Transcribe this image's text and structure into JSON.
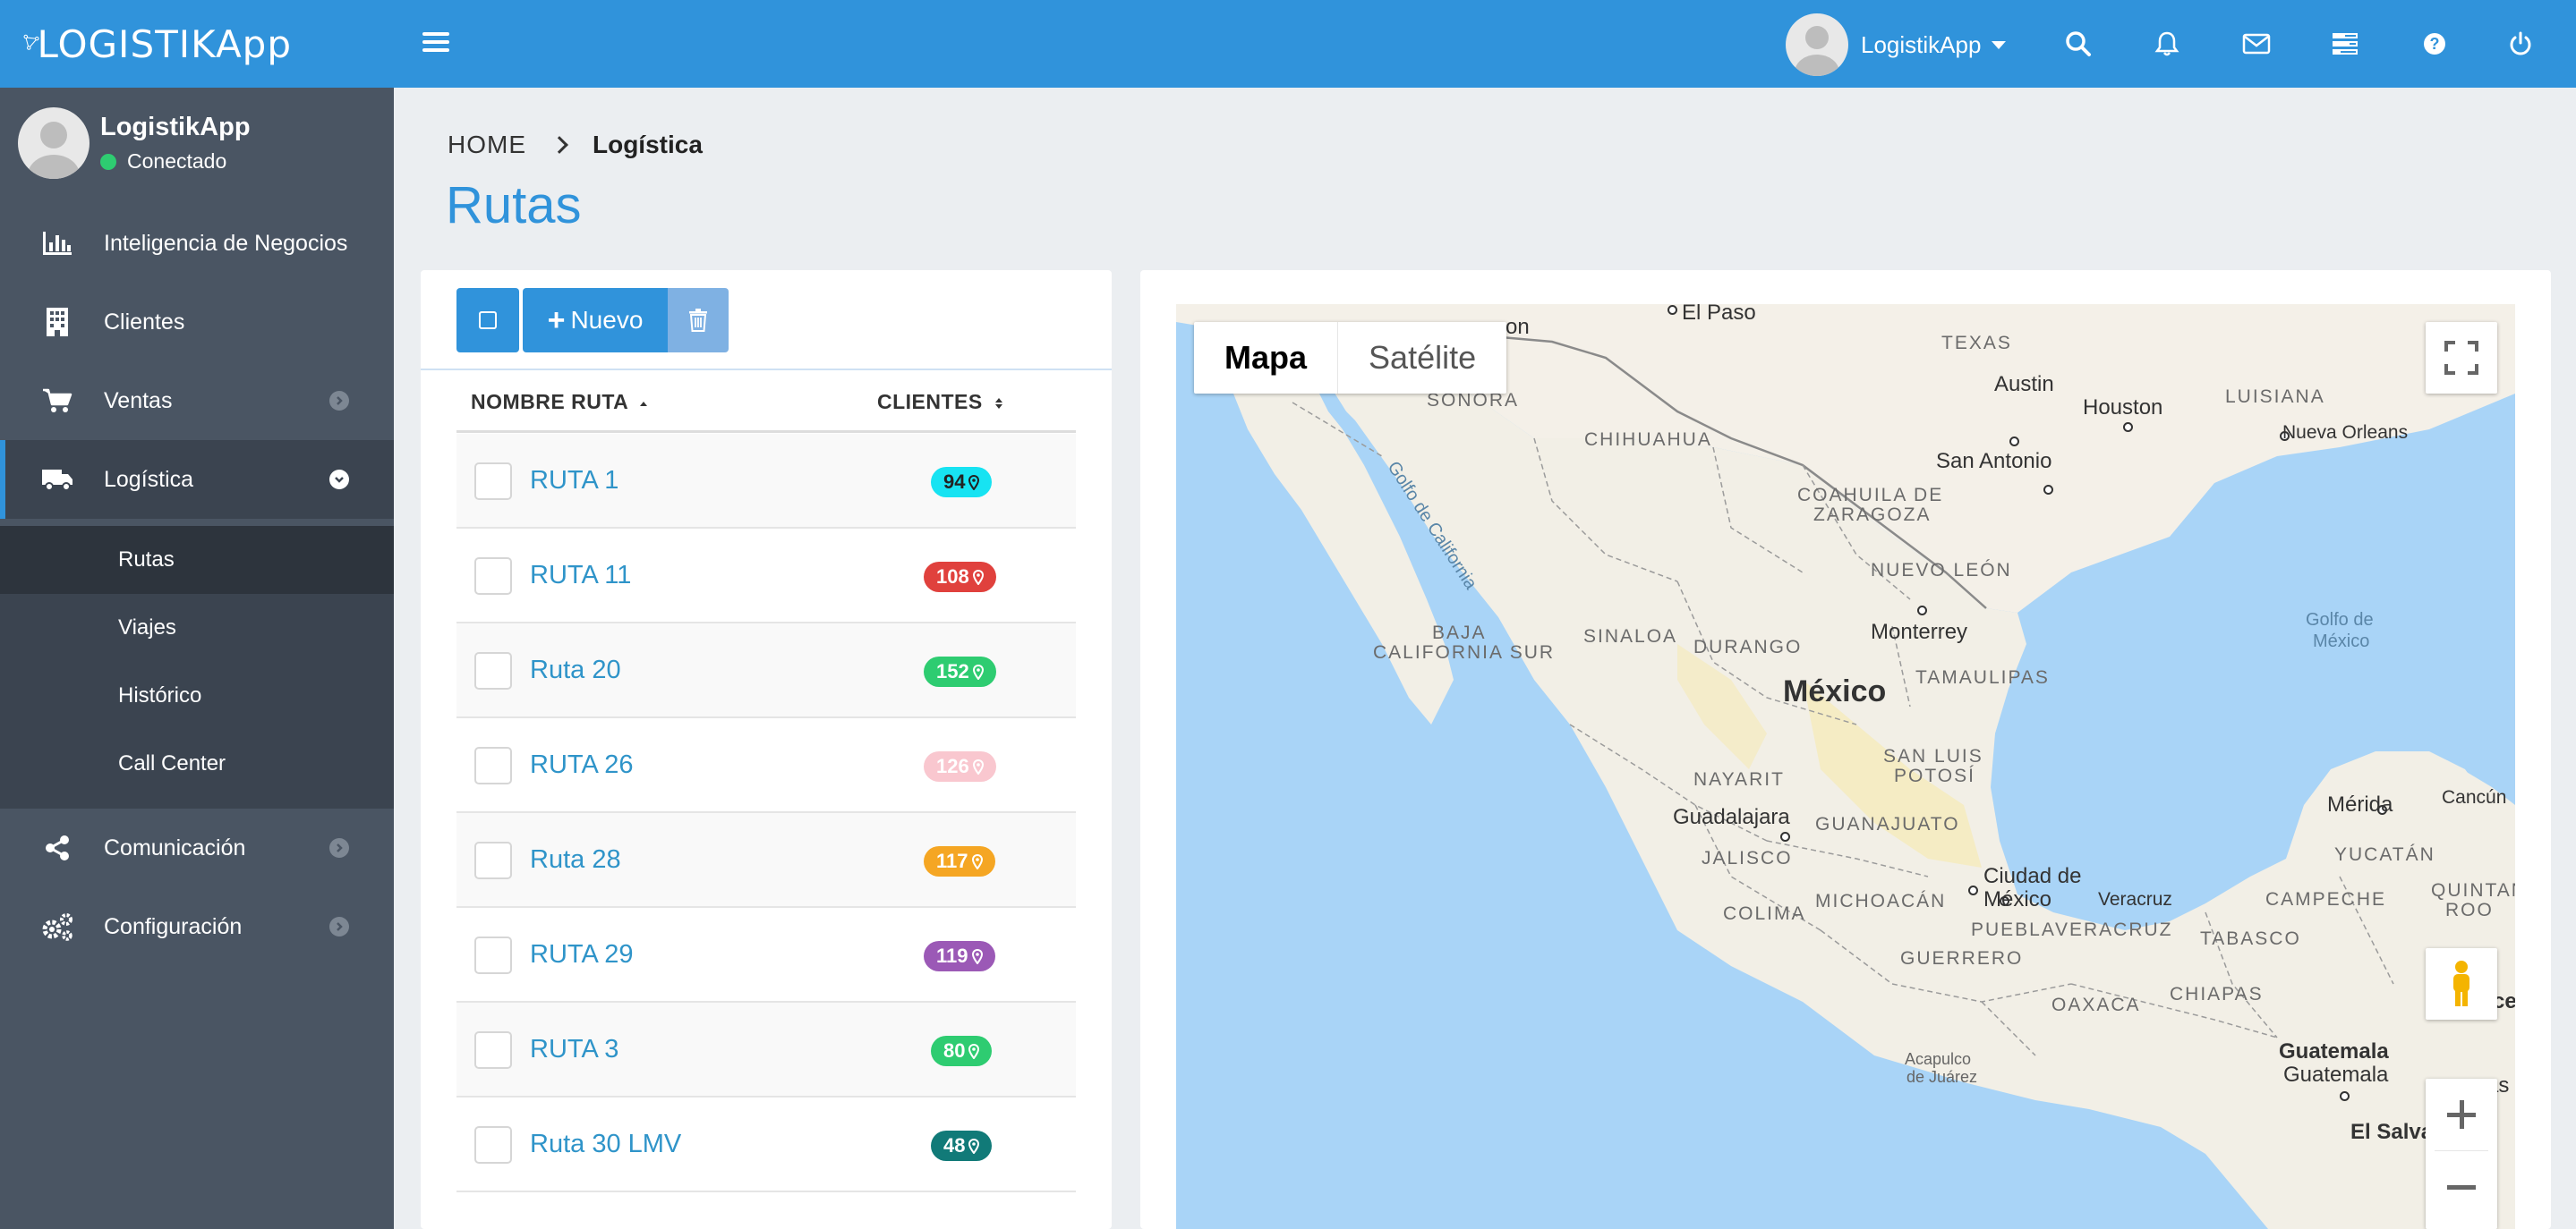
{
  "app": {
    "logo_text": "LOGISTIKApp",
    "user_name": "LogistikApp",
    "status": "Conectado"
  },
  "topbar": {
    "icons": [
      "search-icon",
      "bell-icon",
      "envelope-icon",
      "tasks-icon",
      "question-icon",
      "power-icon"
    ]
  },
  "sidebar": {
    "items": [
      {
        "label": "Inteligencia de Negocios",
        "icon": "bar-chart-icon"
      },
      {
        "label": "Clientes",
        "icon": "building-icon"
      },
      {
        "label": "Ventas",
        "icon": "cart-icon"
      },
      {
        "label": "Logística",
        "icon": "truck-icon"
      },
      {
        "label": "Comunicación",
        "icon": "share-icon"
      },
      {
        "label": "Configuración",
        "icon": "cogs-icon"
      }
    ],
    "subitems": [
      {
        "label": "Rutas"
      },
      {
        "label": "Viajes"
      },
      {
        "label": "Histórico"
      },
      {
        "label": "Call Center"
      }
    ]
  },
  "breadcrumb": {
    "home": "HOME",
    "current": "Logística"
  },
  "page": {
    "title": "Rutas"
  },
  "toolbar": {
    "new_label": "Nuevo"
  },
  "table": {
    "columns": [
      "NOMBRE RUTA",
      "CLIENTES"
    ],
    "rows": [
      {
        "name": "RUTA 1",
        "clients": "94",
        "color": "#17e3f2",
        "text_color": "#222222"
      },
      {
        "name": "RUTA 11",
        "clients": "108",
        "color": "#e0413d",
        "text_color": "#ffffff"
      },
      {
        "name": "Ruta 20",
        "clients": "152",
        "color": "#2ecc71",
        "text_color": "#ffffff"
      },
      {
        "name": "RUTA 26",
        "clients": "126",
        "color": "#f9c7cf",
        "text_color": "#ffffff"
      },
      {
        "name": "Ruta 28",
        "clients": "117",
        "color": "#f5a623",
        "text_color": "#ffffff"
      },
      {
        "name": "RUTA 29",
        "clients": "119",
        "color": "#9b59b6",
        "text_color": "#ffffff"
      },
      {
        "name": "RUTA 3",
        "clients": "80",
        "color": "#2ecc71",
        "text_color": "#ffffff"
      },
      {
        "name": "Ruta 30 LMV",
        "clients": "48",
        "color": "#117a78",
        "text_color": "#ffffff"
      }
    ]
  },
  "map": {
    "type_map": "Mapa",
    "type_satellite": "Satélite",
    "labels": {
      "el_paso": "El Paso",
      "texas": "TEXAS",
      "austin": "Austin",
      "houston": "Houston",
      "luisiana": "LUISIANA",
      "nueva_orleans": "Nueva Orleans",
      "san_antonio": "San Antonio",
      "sonora": "SONORA",
      "chihuahua": "CHIHUAHUA",
      "coahuila": "COAHUILA DE",
      "zaragoza": "ZARAGOZA",
      "nuevo_leon": "NUEVO LEÓN",
      "golfo_california": "Golfo de California",
      "monterrey": "Monterrey",
      "golfo_mexico_1": "Golfo de",
      "golfo_mexico_2": "México",
      "baja_1": "BAJA",
      "baja_2": "CALIFORNIA SUR",
      "sinaloa": "SINALOA",
      "durango": "DURANGO",
      "tamaulipas": "TAMAULIPAS",
      "mexico": "México",
      "nayarit": "NAYARIT",
      "san_luis_1": "SAN LUIS",
      "san_luis_2": "POTOSÍ",
      "merida": "Mérida",
      "cancun": "Cancún",
      "guadalajara": "Guadalajara",
      "guanajuato": "GUANAJUATO",
      "yucatan": "YUCATÁN",
      "jalisco": "JALISCO",
      "cdmx_1": "Ciudad de",
      "cdmx_2": "México",
      "veracruz_city": "Veracruz",
      "campeche": "CAMPECHE",
      "quintana_1": "QUINTANA",
      "quintana_2": "ROO",
      "colima": "COLIMA",
      "michoacan": "MICHOACÁN",
      "puebla": "PUEBLA",
      "veracruz": "VERACRUZ",
      "tabasco": "TABASCO",
      "guerrero": "GUERRERO",
      "oaxaca": "OAXACA",
      "chiapas": "CHIAPAS",
      "belice": "Belice",
      "acapulco_1": "Acapulco",
      "acapulco_2": "de Juárez",
      "guatemala_country": "Guatemala",
      "guatemala_city": "Guatemala",
      "el_salvador": "El Salva",
      "on": "on",
      "hondura_frag": "as"
    }
  }
}
